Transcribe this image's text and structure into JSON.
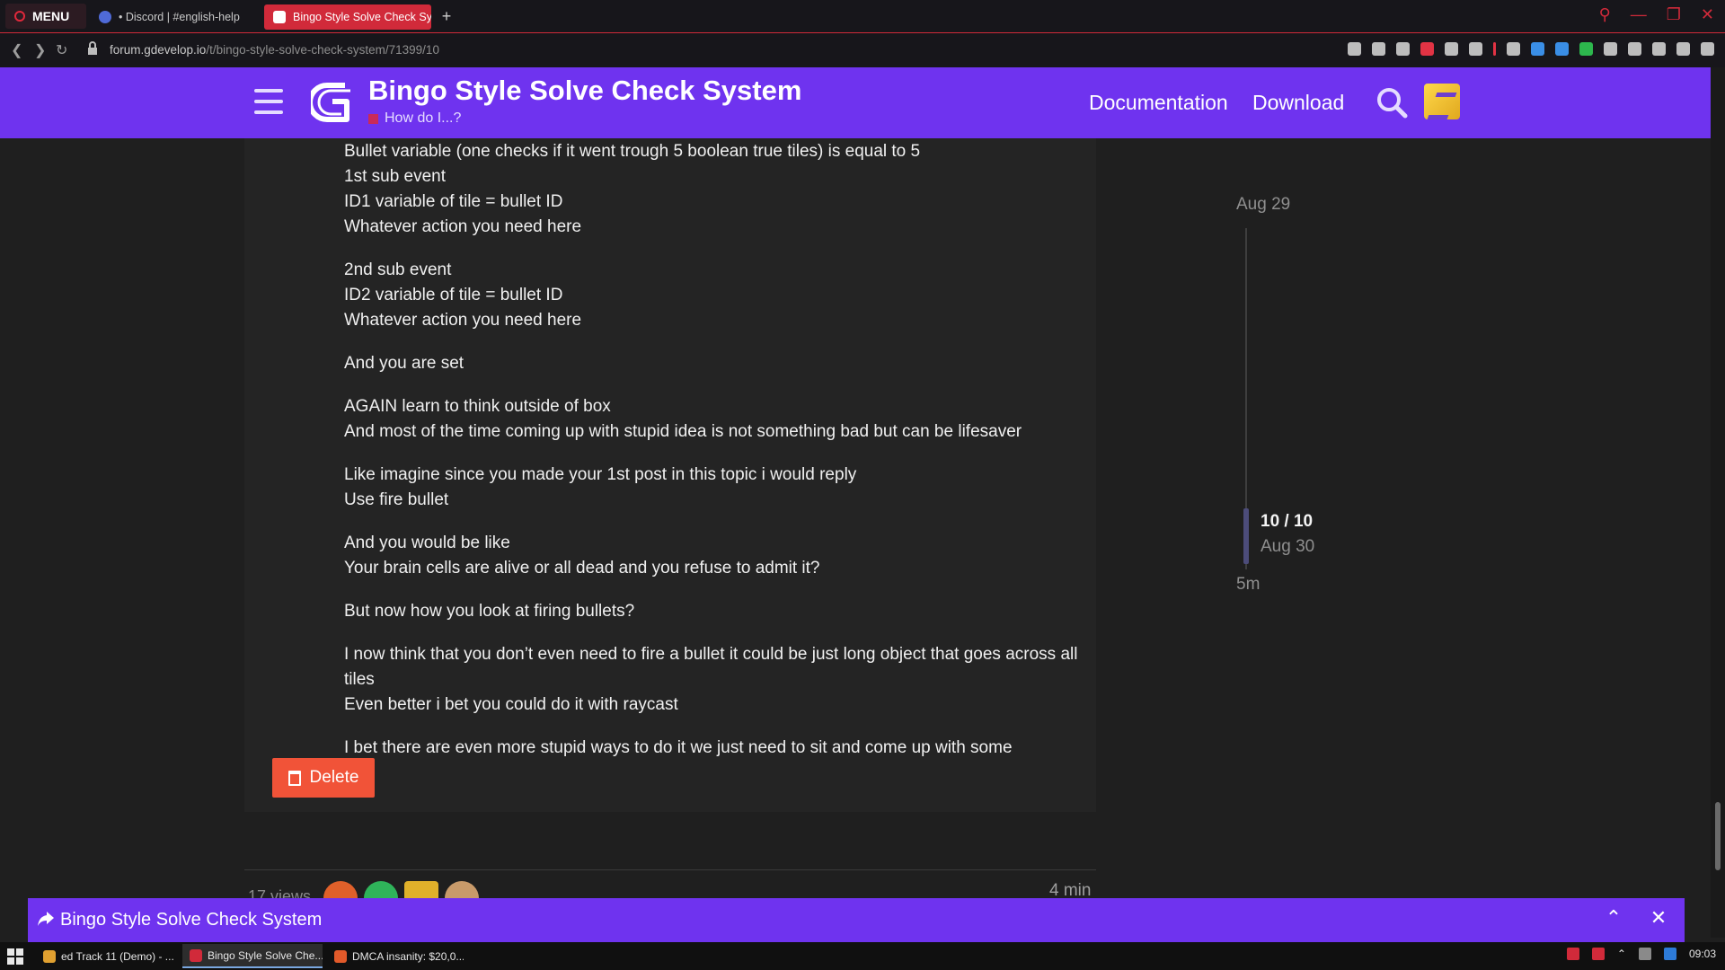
{
  "browser": {
    "menu_label": "MENU",
    "tabs": [
      {
        "label": "• Discord | #english-help"
      },
      {
        "label": "Bingo Style Solve Check System"
      }
    ],
    "url_host": "forum.gdevelop.io",
    "url_path": "/t/bingo-style-solve-check-system/71399/10"
  },
  "header": {
    "title": "Bingo Style Solve Check System",
    "category": "How do I...?",
    "nav": {
      "docs": "Documentation",
      "download": "Download"
    }
  },
  "post": {
    "paragraphs": [
      [
        "Bullet variable (one checks if it went trough 5 boolean true tiles) is equal to 5",
        "1st sub event",
        "ID1 variable of tile = bullet ID",
        "Whatever action you need here"
      ],
      [
        "2nd sub event",
        "ID2 variable of tile = bullet ID",
        "Whatever action you need here"
      ],
      [
        "And you are set"
      ],
      [
        "AGAIN learn to think outside of box",
        "And most of the time coming up with stupid idea is not something bad but can be lifesaver"
      ],
      [
        "Like imagine since you made your 1st post in this topic i would reply",
        "Use fire bullet"
      ],
      [
        "And you would be like",
        "Your brain cells are alive or all dead and you refuse to admit it?"
      ],
      [
        "But now how you look at firing bullets?"
      ],
      [
        "I now think that you don’t even need to fire a bullet it could be just long object that goes across all tiles",
        "Even better i bet you could do it with raycast"
      ],
      [
        "I bet there are even more stupid ways to do it we just need to sit and come up with some"
      ]
    ],
    "delete_label": "Delete",
    "footer": {
      "views": "17 views",
      "read_time": "4 min"
    }
  },
  "timeline": {
    "start_date": "Aug 29",
    "position": "10 / 10",
    "current_date": "Aug 30",
    "end_label": "5m"
  },
  "reply_bar": {
    "title": "Bingo Style Solve Check System"
  },
  "taskbar": {
    "items": [
      {
        "label": "ed Track 11 (Demo) - ..."
      },
      {
        "label": "Bingo Style Solve Che..."
      },
      {
        "label": "DMCA insanity: $20,0..."
      }
    ],
    "clock": "09:03"
  },
  "colors": {
    "brand_purple": "#6f33ef",
    "delete_orange": "#f15338",
    "browser_accent": "#d12a3a"
  },
  "icons": [
    "menu-icon",
    "hamburger-icon",
    "gdevelop-logo",
    "search-icon",
    "reply-icon",
    "chevron-up-icon",
    "close-icon",
    "trash-icon",
    "windows-start-icon"
  ]
}
